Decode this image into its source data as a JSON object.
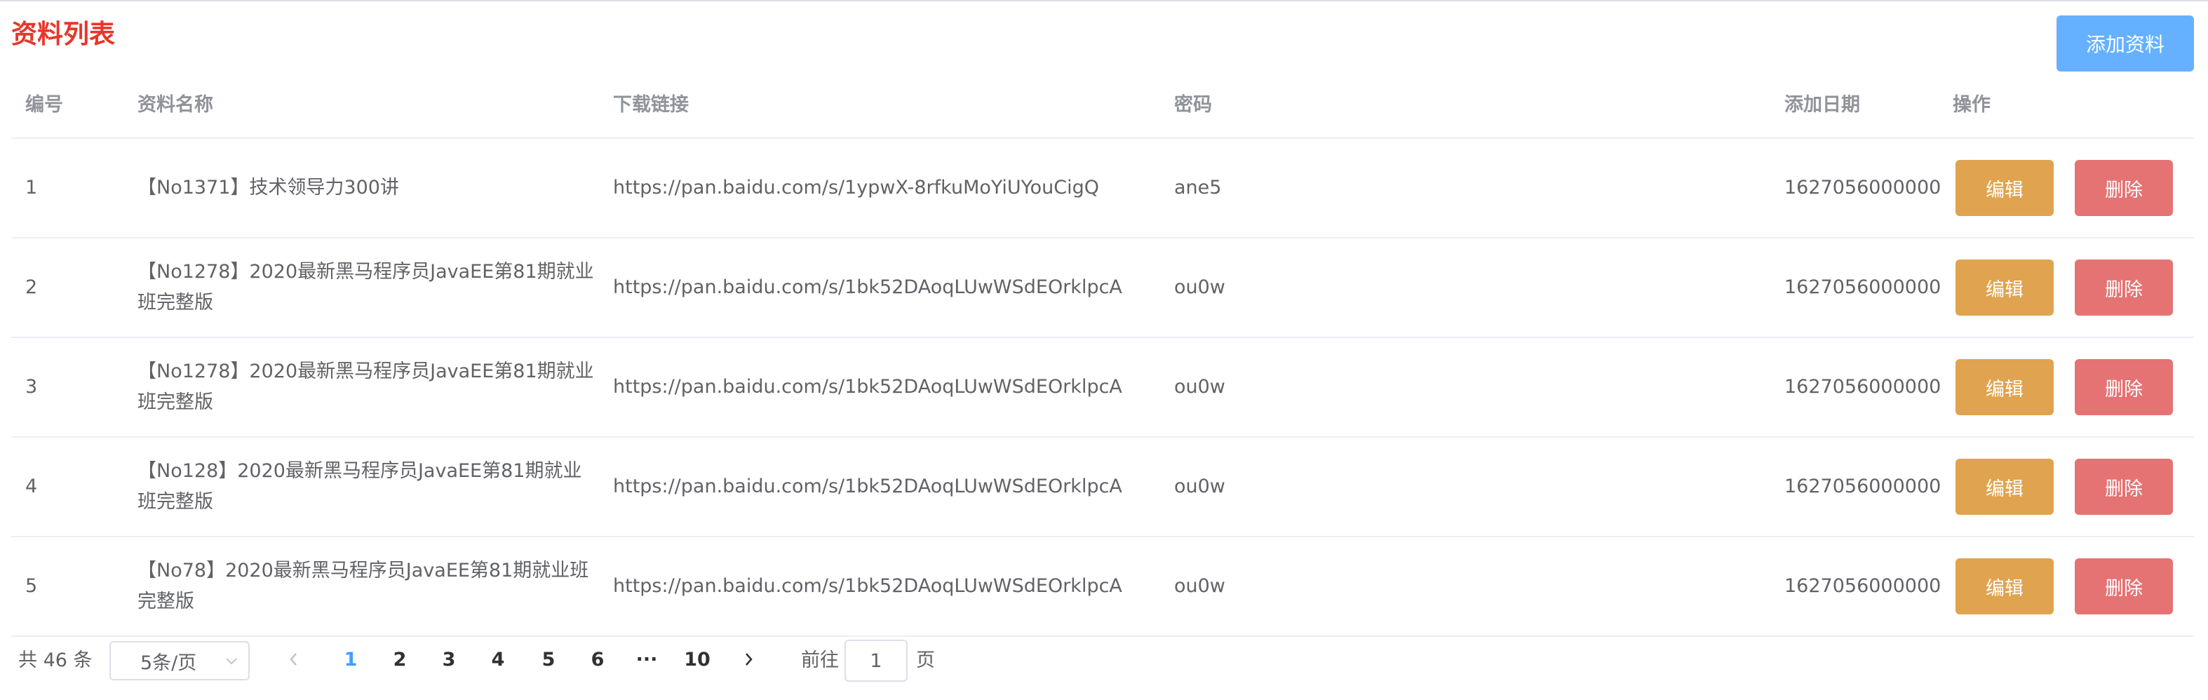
{
  "page": {
    "title": "资料列表",
    "add_button_label": "添加资料"
  },
  "table": {
    "headers": {
      "no": "编号",
      "name": "资料名称",
      "link": "下载链接",
      "password": "密码",
      "date": "添加日期",
      "ops": "操作"
    },
    "rows": [
      {
        "no": "1",
        "name": "【No1371】技术领导力300讲",
        "link": "https://pan.baidu.com/s/1ypwX-8rfkuMoYiUYouCigQ",
        "password": "ane5",
        "date": "1627056000000"
      },
      {
        "no": "2",
        "name": "【No1278】2020最新黑马程序员JavaEE第81期就业班完整版",
        "link": "https://pan.baidu.com/s/1bk52DAoqLUwWSdEOrklpcA",
        "password": "ou0w",
        "date": "1627056000000"
      },
      {
        "no": "3",
        "name": "【No1278】2020最新黑马程序员JavaEE第81期就业班完整版",
        "link": "https://pan.baidu.com/s/1bk52DAoqLUwWSdEOrklpcA",
        "password": "ou0w",
        "date": "1627056000000"
      },
      {
        "no": "4",
        "name": "【No128】2020最新黑马程序员JavaEE第81期就业班完整版",
        "link": "https://pan.baidu.com/s/1bk52DAoqLUwWSdEOrklpcA",
        "password": "ou0w",
        "date": "1627056000000"
      },
      {
        "no": "5",
        "name": "【No78】2020最新黑马程序员JavaEE第81期就业班完整版",
        "link": "https://pan.baidu.com/s/1bk52DAoqLUwWSdEOrklpcA",
        "password": "ou0w",
        "date": "1627056000000"
      }
    ],
    "edit_label": "编辑",
    "delete_label": "删除"
  },
  "pagination": {
    "total_text": "共 46 条",
    "page_size": "5条/页",
    "pages": [
      "1",
      "2",
      "3",
      "4",
      "5",
      "6",
      "···",
      "10"
    ],
    "current_page": "1",
    "goto_label": "前往",
    "goto_value": "1",
    "goto_suffix": "页"
  },
  "colors": {
    "title": "#e8362b",
    "primary": "#66b1ff",
    "edit": "#e0a34f",
    "delete": "#e57373",
    "active_page": "#409eff"
  }
}
